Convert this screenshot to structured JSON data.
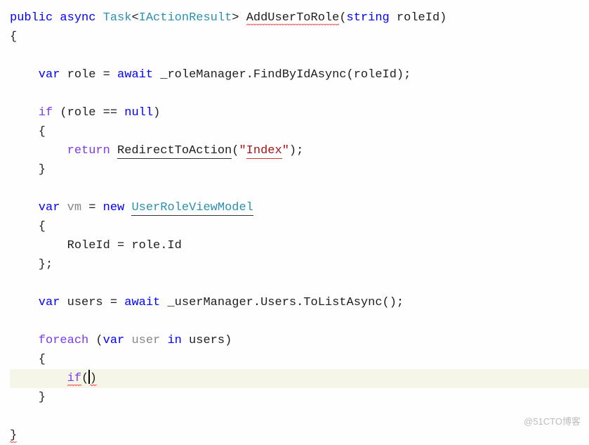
{
  "code": {
    "l1_public": "public",
    "l1_async": "async",
    "l1_task": "Task",
    "l1_lt": "<",
    "l1_iresult": "IActionResult",
    "l1_gt": "> ",
    "l1_method": "AddUserToRole",
    "l1_paren_open": "(",
    "l1_string": "string",
    "l1_param": " roleId)",
    "l2": "{",
    "l3_var": "    var",
    "l3_space": " role = ",
    "l3_await": "await",
    "l3_call": " _roleManager.FindByIdAsync(roleId);",
    "l5_if": "    if",
    "l5_cond": " (role == ",
    "l5_null": "null",
    "l5_close": ")",
    "l6": "    {",
    "l7_return": "        return",
    "l7_space": " ",
    "l7_redirect": "RedirectToAction",
    "l7_p1": "(",
    "l7_q1": "\"",
    "l7_str": "Index",
    "l7_q2": "\"",
    "l7_end": ");",
    "l8": "    }",
    "l10_var": "    var",
    "l10_space1": " ",
    "l10_vm": "vm",
    "l10_eq": " = ",
    "l10_new": "new",
    "l10_space2": " ",
    "l10_type": "UserRoleViewModel",
    "l11": "    {",
    "l12": "        RoleId = role.Id",
    "l13": "    };",
    "l15_var": "    var",
    "l15_rest": " users = ",
    "l15_await": "await",
    "l15_call": " _userManager.Users.ToListAsync();",
    "l17_foreach": "    foreach",
    "l17_p": " (",
    "l17_var": "var",
    "l17_sp": " ",
    "l17_user": "user",
    "l17_sp2": " ",
    "l17_in": "in",
    "l17_rest": " users)",
    "l18": "    {",
    "l19_sp": "        ",
    "l19_if": "if",
    "l19_p": "(",
    "l19_close": ")",
    "l20": "    }",
    "l22": "}"
  },
  "watermark": "@51CTO博客"
}
